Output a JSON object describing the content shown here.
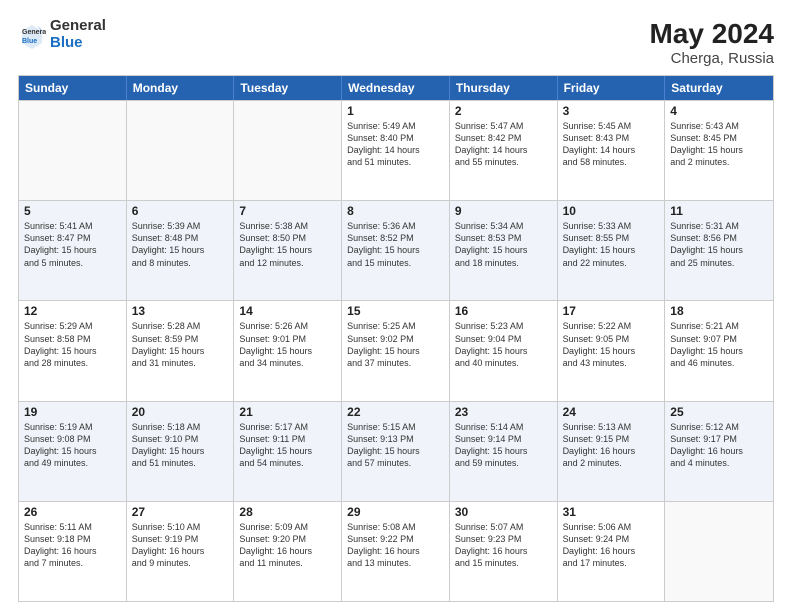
{
  "header": {
    "logo": {
      "general": "General",
      "blue": "Blue"
    },
    "title": "May 2024",
    "location": "Cherga, Russia"
  },
  "weekdays": [
    "Sunday",
    "Monday",
    "Tuesday",
    "Wednesday",
    "Thursday",
    "Friday",
    "Saturday"
  ],
  "rows": [
    {
      "alt": false,
      "cells": [
        {
          "day": "",
          "info": ""
        },
        {
          "day": "",
          "info": ""
        },
        {
          "day": "",
          "info": ""
        },
        {
          "day": "1",
          "info": "Sunrise: 5:49 AM\nSunset: 8:40 PM\nDaylight: 14 hours\nand 51 minutes."
        },
        {
          "day": "2",
          "info": "Sunrise: 5:47 AM\nSunset: 8:42 PM\nDaylight: 14 hours\nand 55 minutes."
        },
        {
          "day": "3",
          "info": "Sunrise: 5:45 AM\nSunset: 8:43 PM\nDaylight: 14 hours\nand 58 minutes."
        },
        {
          "day": "4",
          "info": "Sunrise: 5:43 AM\nSunset: 8:45 PM\nDaylight: 15 hours\nand 2 minutes."
        }
      ]
    },
    {
      "alt": true,
      "cells": [
        {
          "day": "5",
          "info": "Sunrise: 5:41 AM\nSunset: 8:47 PM\nDaylight: 15 hours\nand 5 minutes."
        },
        {
          "day": "6",
          "info": "Sunrise: 5:39 AM\nSunset: 8:48 PM\nDaylight: 15 hours\nand 8 minutes."
        },
        {
          "day": "7",
          "info": "Sunrise: 5:38 AM\nSunset: 8:50 PM\nDaylight: 15 hours\nand 12 minutes."
        },
        {
          "day": "8",
          "info": "Sunrise: 5:36 AM\nSunset: 8:52 PM\nDaylight: 15 hours\nand 15 minutes."
        },
        {
          "day": "9",
          "info": "Sunrise: 5:34 AM\nSunset: 8:53 PM\nDaylight: 15 hours\nand 18 minutes."
        },
        {
          "day": "10",
          "info": "Sunrise: 5:33 AM\nSunset: 8:55 PM\nDaylight: 15 hours\nand 22 minutes."
        },
        {
          "day": "11",
          "info": "Sunrise: 5:31 AM\nSunset: 8:56 PM\nDaylight: 15 hours\nand 25 minutes."
        }
      ]
    },
    {
      "alt": false,
      "cells": [
        {
          "day": "12",
          "info": "Sunrise: 5:29 AM\nSunset: 8:58 PM\nDaylight: 15 hours\nand 28 minutes."
        },
        {
          "day": "13",
          "info": "Sunrise: 5:28 AM\nSunset: 8:59 PM\nDaylight: 15 hours\nand 31 minutes."
        },
        {
          "day": "14",
          "info": "Sunrise: 5:26 AM\nSunset: 9:01 PM\nDaylight: 15 hours\nand 34 minutes."
        },
        {
          "day": "15",
          "info": "Sunrise: 5:25 AM\nSunset: 9:02 PM\nDaylight: 15 hours\nand 37 minutes."
        },
        {
          "day": "16",
          "info": "Sunrise: 5:23 AM\nSunset: 9:04 PM\nDaylight: 15 hours\nand 40 minutes."
        },
        {
          "day": "17",
          "info": "Sunrise: 5:22 AM\nSunset: 9:05 PM\nDaylight: 15 hours\nand 43 minutes."
        },
        {
          "day": "18",
          "info": "Sunrise: 5:21 AM\nSunset: 9:07 PM\nDaylight: 15 hours\nand 46 minutes."
        }
      ]
    },
    {
      "alt": true,
      "cells": [
        {
          "day": "19",
          "info": "Sunrise: 5:19 AM\nSunset: 9:08 PM\nDaylight: 15 hours\nand 49 minutes."
        },
        {
          "day": "20",
          "info": "Sunrise: 5:18 AM\nSunset: 9:10 PM\nDaylight: 15 hours\nand 51 minutes."
        },
        {
          "day": "21",
          "info": "Sunrise: 5:17 AM\nSunset: 9:11 PM\nDaylight: 15 hours\nand 54 minutes."
        },
        {
          "day": "22",
          "info": "Sunrise: 5:15 AM\nSunset: 9:13 PM\nDaylight: 15 hours\nand 57 minutes."
        },
        {
          "day": "23",
          "info": "Sunrise: 5:14 AM\nSunset: 9:14 PM\nDaylight: 15 hours\nand 59 minutes."
        },
        {
          "day": "24",
          "info": "Sunrise: 5:13 AM\nSunset: 9:15 PM\nDaylight: 16 hours\nand 2 minutes."
        },
        {
          "day": "25",
          "info": "Sunrise: 5:12 AM\nSunset: 9:17 PM\nDaylight: 16 hours\nand 4 minutes."
        }
      ]
    },
    {
      "alt": false,
      "cells": [
        {
          "day": "26",
          "info": "Sunrise: 5:11 AM\nSunset: 9:18 PM\nDaylight: 16 hours\nand 7 minutes."
        },
        {
          "day": "27",
          "info": "Sunrise: 5:10 AM\nSunset: 9:19 PM\nDaylight: 16 hours\nand 9 minutes."
        },
        {
          "day": "28",
          "info": "Sunrise: 5:09 AM\nSunset: 9:20 PM\nDaylight: 16 hours\nand 11 minutes."
        },
        {
          "day": "29",
          "info": "Sunrise: 5:08 AM\nSunset: 9:22 PM\nDaylight: 16 hours\nand 13 minutes."
        },
        {
          "day": "30",
          "info": "Sunrise: 5:07 AM\nSunset: 9:23 PM\nDaylight: 16 hours\nand 15 minutes."
        },
        {
          "day": "31",
          "info": "Sunrise: 5:06 AM\nSunset: 9:24 PM\nDaylight: 16 hours\nand 17 minutes."
        },
        {
          "day": "",
          "info": ""
        }
      ]
    }
  ]
}
